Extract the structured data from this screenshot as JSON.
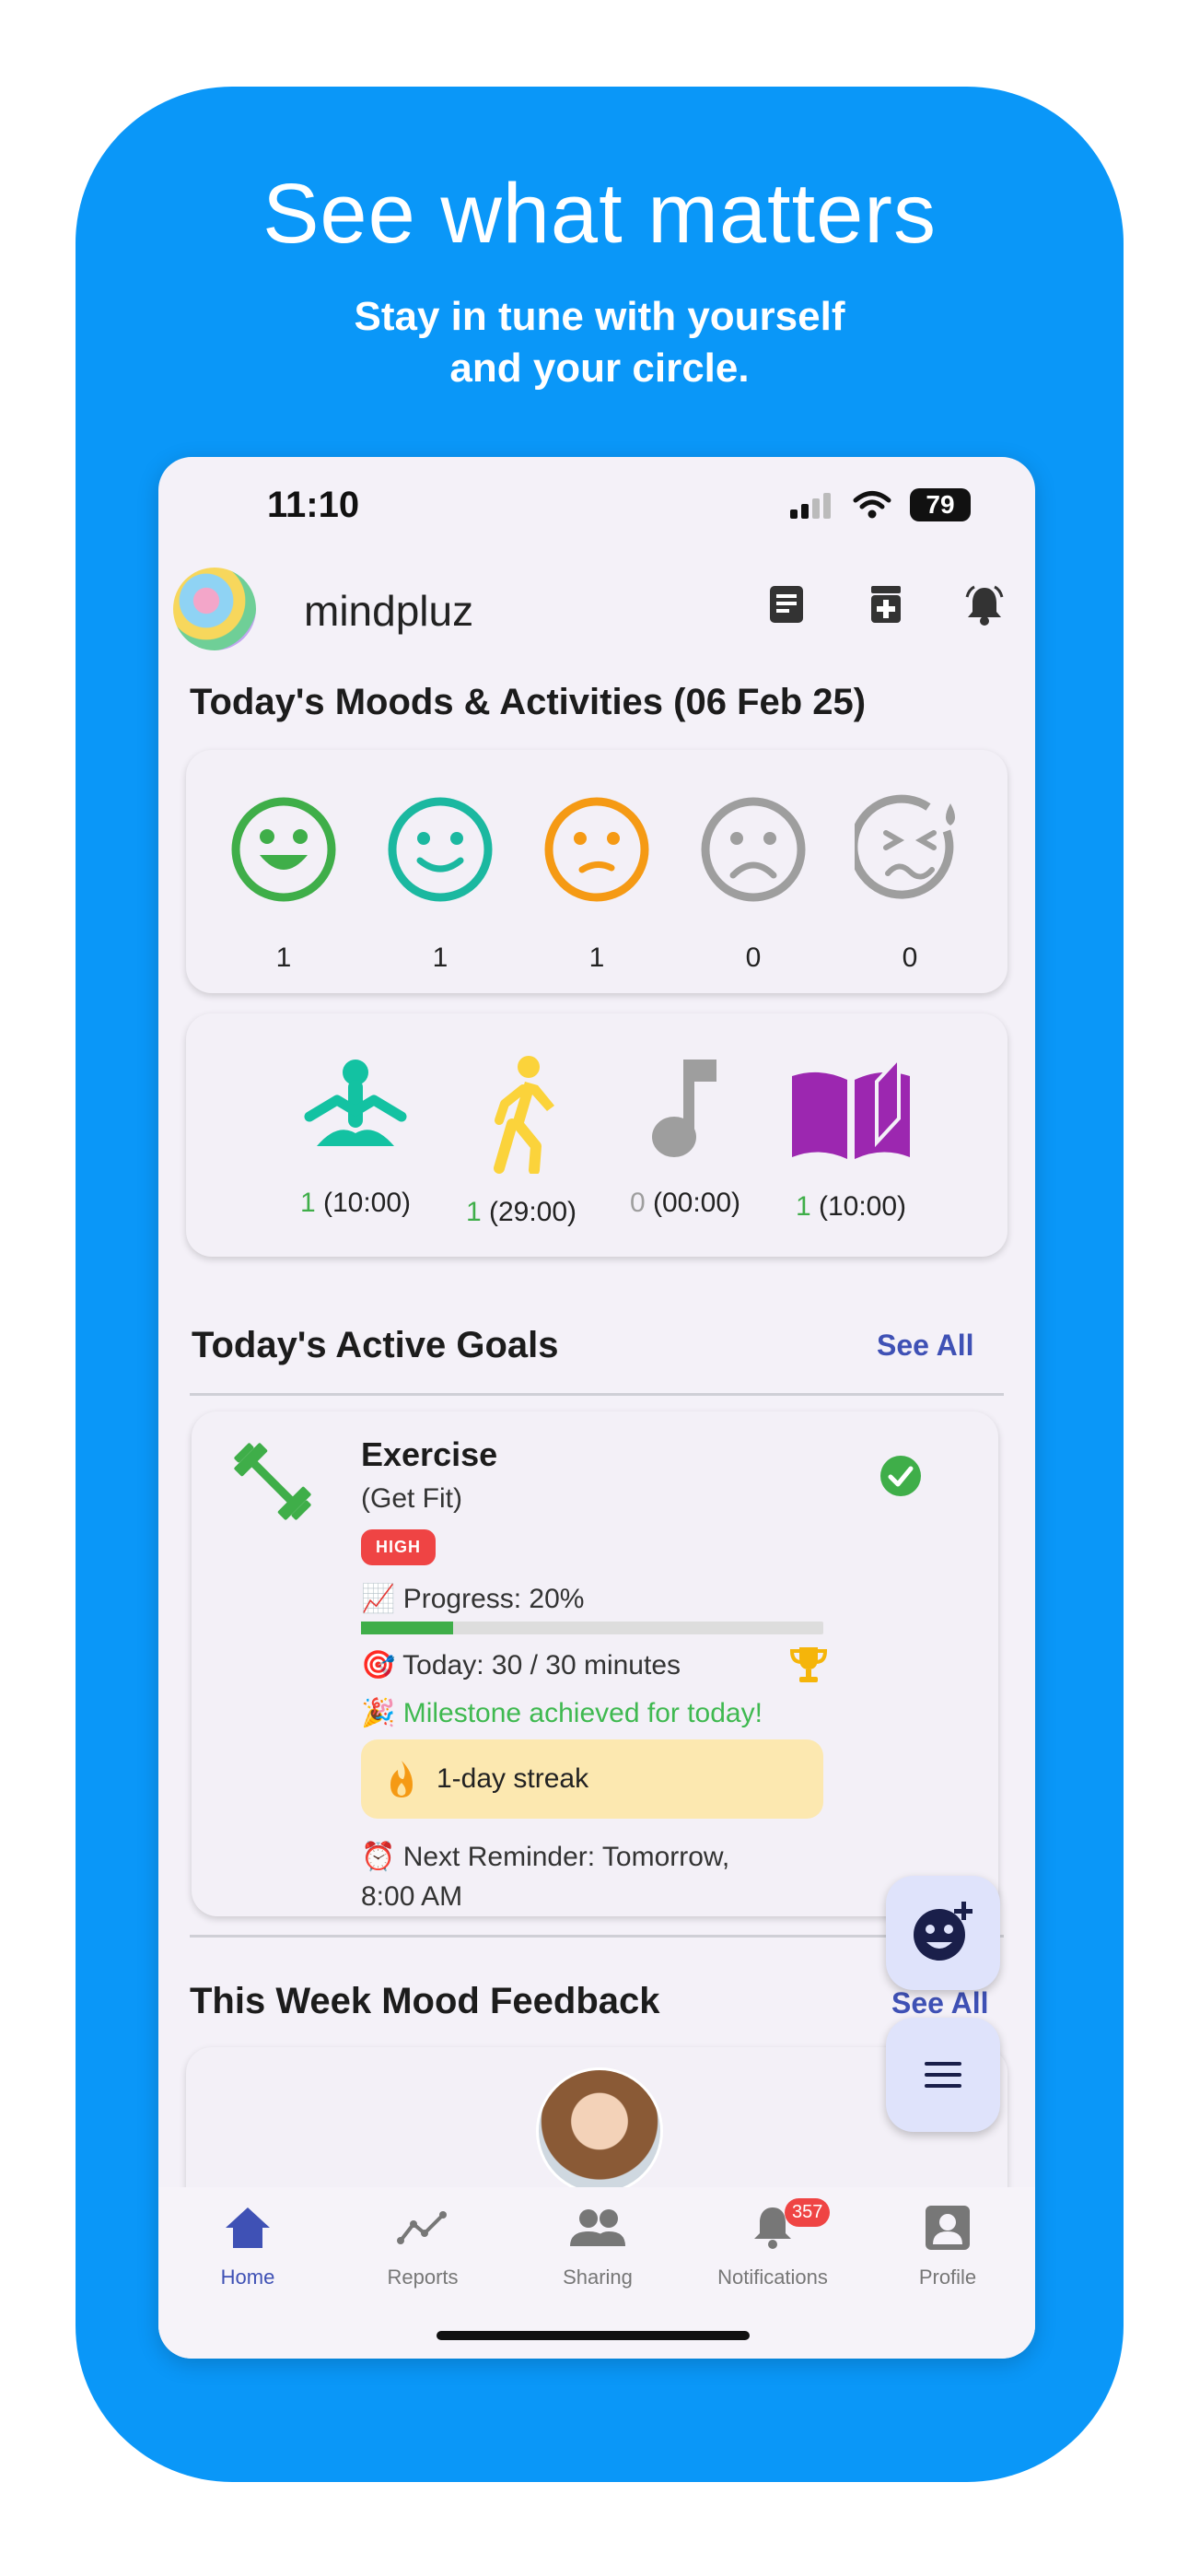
{
  "promo": {
    "headline": "See what matters",
    "subhead_line1": "Stay in tune with yourself",
    "subhead_line2": "and your circle.",
    "background_color": "#0a97f8"
  },
  "status_bar": {
    "time": "11:10",
    "battery": "79"
  },
  "header": {
    "app_name": "mindpluz",
    "icons": [
      "notes-icon",
      "medical-icon",
      "bell-icon"
    ]
  },
  "moods": {
    "title": "Today's Moods & Activities (06 Feb 25)",
    "items": [
      {
        "icon": "very-happy-face-icon",
        "count": "1",
        "color": "#3fae49"
      },
      {
        "icon": "happy-face-icon",
        "count": "1",
        "color": "#1bb8a0"
      },
      {
        "icon": "neutral-face-icon",
        "count": "1",
        "color": "#f59a14"
      },
      {
        "icon": "sad-face-icon",
        "count": "0",
        "color": "#9e9e9e"
      },
      {
        "icon": "crying-face-icon",
        "count": "0",
        "color": "#9e9e9e"
      }
    ]
  },
  "activities": [
    {
      "icon": "meditation-icon",
      "count": "1",
      "duration": "(10:00)",
      "color": "#13c2a2"
    },
    {
      "icon": "walking-icon",
      "count": "1",
      "duration": "(29:00)",
      "color": "#fbd33b"
    },
    {
      "icon": "music-note-icon",
      "count": "0",
      "duration": "(00:00)",
      "color": "#9e9e9e"
    },
    {
      "icon": "book-icon",
      "count": "1",
      "duration": "(10:00)",
      "color": "#9c27b0"
    }
  ],
  "goals": {
    "title": "Today's Active Goals",
    "see_all": "See All",
    "card": {
      "title": "Exercise",
      "subtitle": "(Get Fit)",
      "priority": "HIGH",
      "progress_label": "Progress: 20%",
      "progress": 0.2,
      "today": "Today: 30 / 30 minutes",
      "milestone": "Milestone achieved for today!",
      "streak": "1-day streak",
      "reminder_line1": "Next Reminder: Tomorrow,",
      "reminder_line2": "8:00 AM"
    }
  },
  "feedback": {
    "title": "This Week Mood Feedback",
    "see_all": "See All"
  },
  "nav": {
    "items": [
      {
        "label": "Home",
        "icon": "home-icon"
      },
      {
        "label": "Reports",
        "icon": "chart-line-icon"
      },
      {
        "label": "Sharing",
        "icon": "people-icon"
      },
      {
        "label": "Notifications",
        "icon": "bell-icon",
        "badge": "357"
      },
      {
        "label": "Profile",
        "icon": "profile-icon"
      }
    ]
  }
}
